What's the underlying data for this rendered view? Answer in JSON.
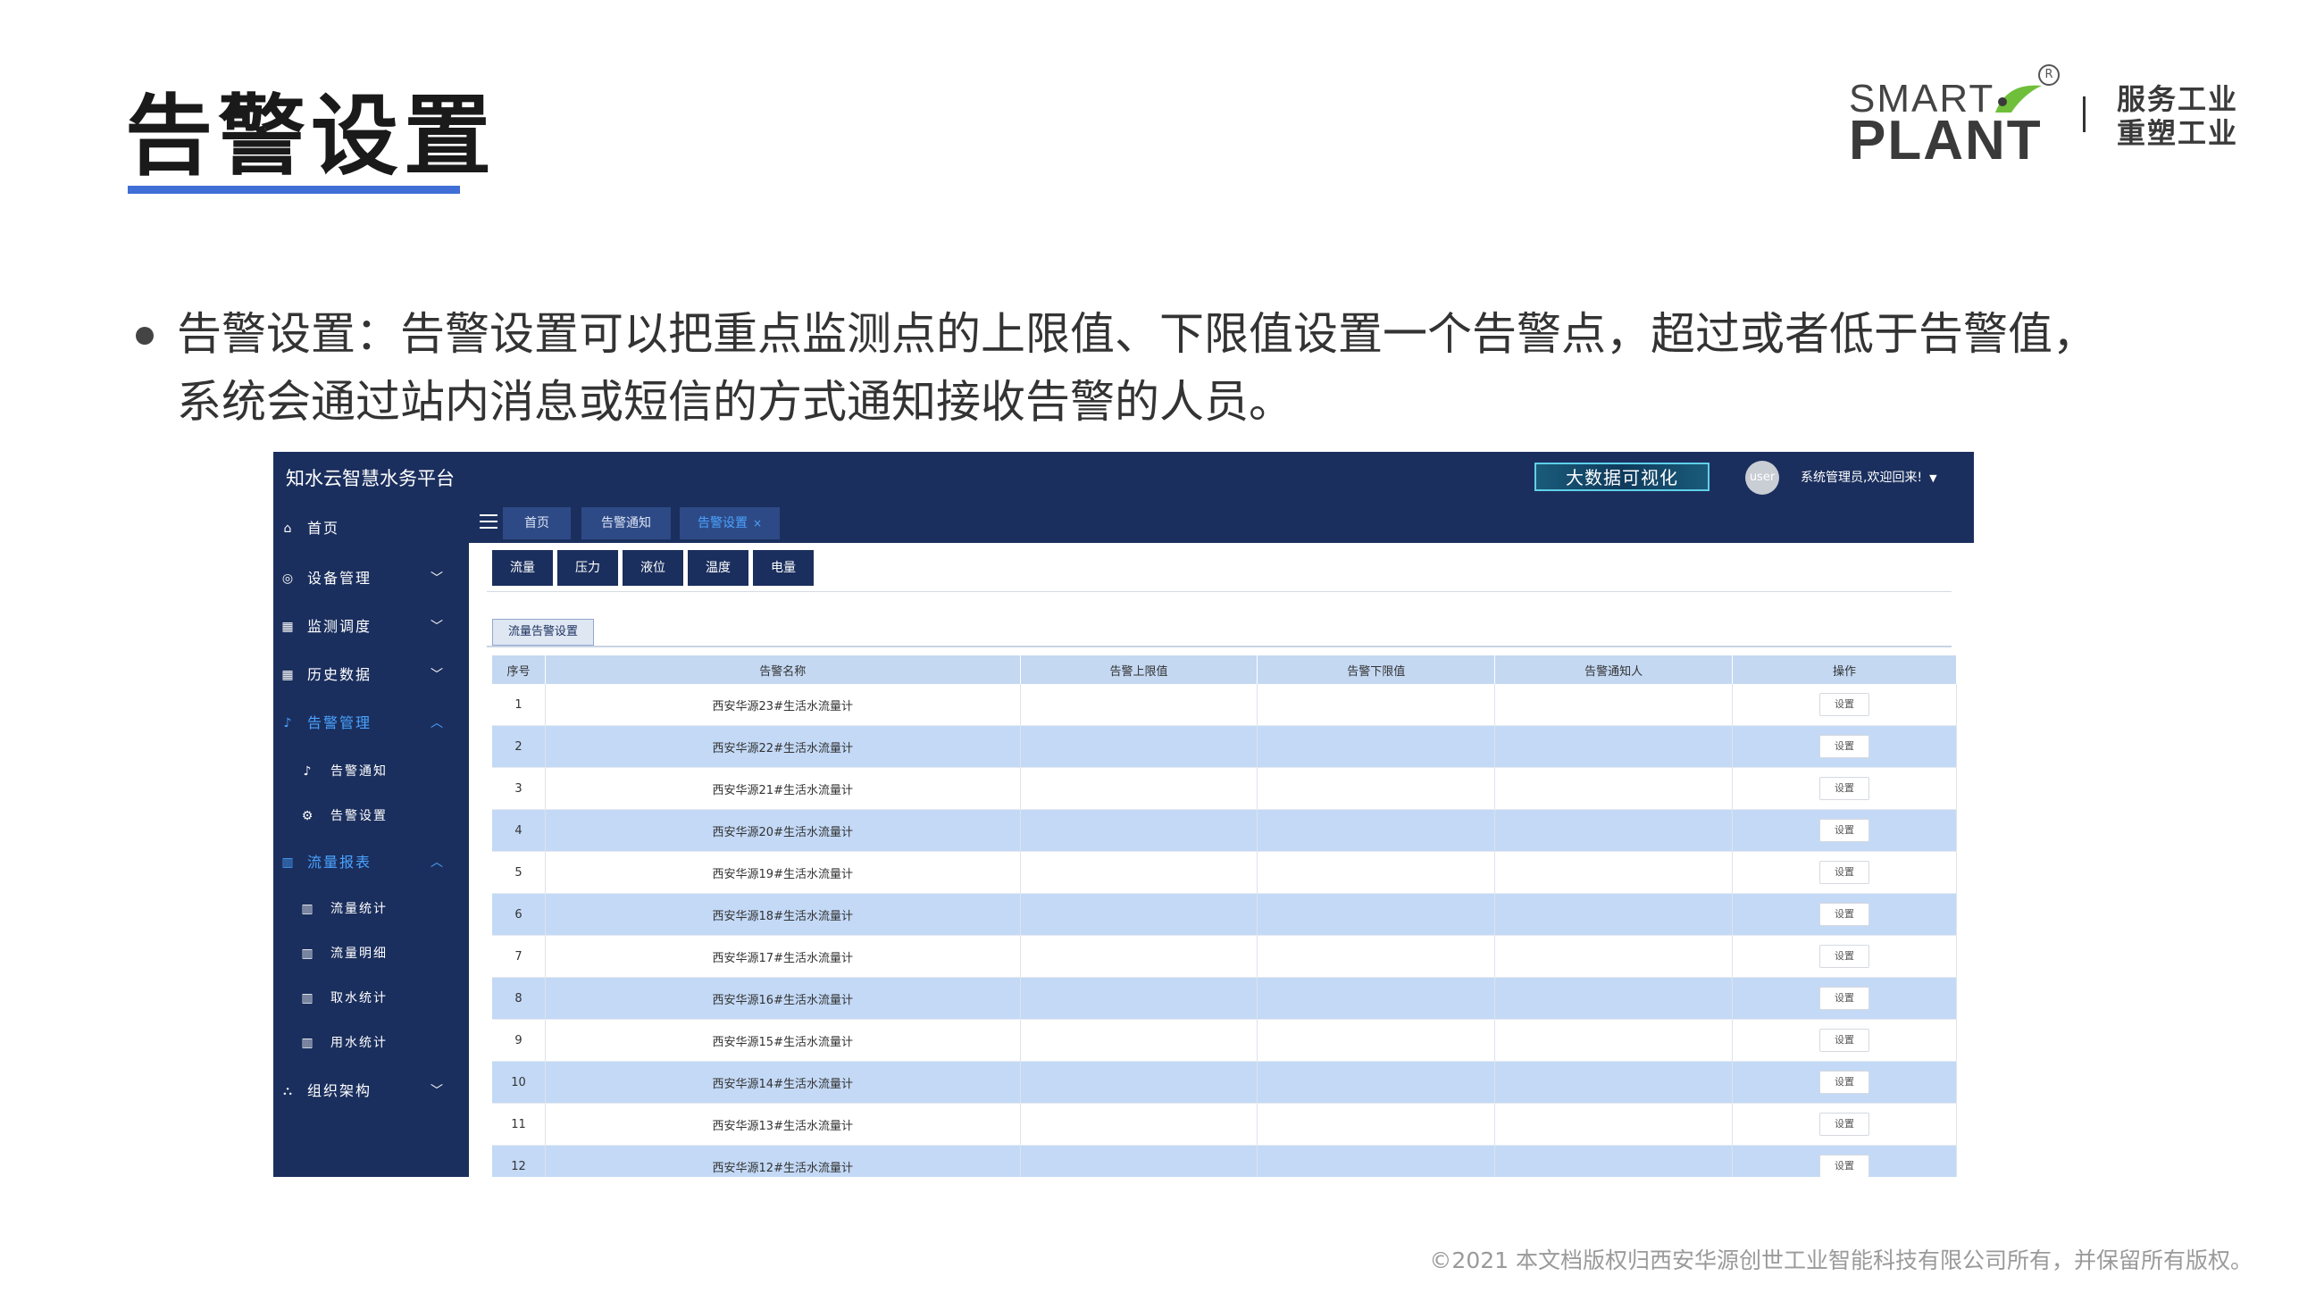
{
  "slide": {
    "title": "告警设置",
    "bullet_line1": "告警设置：告警设置可以把重点监测点的上限值、下限值设置一个告警点，超过或者低于告警值，",
    "bullet_line2": "系统会通过站内消息或短信的方式通知接收告警的人员。",
    "copyright": "©2021 本文档版权归西安华源创世工业智能科技有限公司所有，并保留所有版权。",
    "logo": {
      "smart": "SMART",
      "plant": "PLANT",
      "reg": "R",
      "slogan_line1": "服务工业",
      "slogan_line2": "重塑工业"
    }
  },
  "app": {
    "title": "知水云智慧水务平台",
    "bigdata_button": "大数据可视化",
    "avatar_label": "user",
    "welcome": "系统管理员,欢迎回来!",
    "sidebar": [
      {
        "label": "首页",
        "icon": "home-icon",
        "expandable": false,
        "active": false
      },
      {
        "label": "设备管理",
        "icon": "device-icon",
        "expandable": true,
        "active": false
      },
      {
        "label": "监测调度",
        "icon": "monitor-icon",
        "expandable": true,
        "active": false
      },
      {
        "label": "历史数据",
        "icon": "history-icon",
        "expandable": true,
        "active": false
      },
      {
        "label": "告警管理",
        "icon": "bell-icon",
        "expandable": true,
        "expanded": true,
        "active": true
      },
      {
        "label": "告警通知",
        "icon": "bell-icon",
        "sub": true
      },
      {
        "label": "告警设置",
        "icon": "gear-icon",
        "sub": true
      },
      {
        "label": "流量报表",
        "icon": "bar-chart-icon",
        "expandable": true,
        "expanded": true,
        "active": true
      },
      {
        "label": "流量统计",
        "icon": "bar-chart-icon",
        "sub": true
      },
      {
        "label": "流量明细",
        "icon": "bar-chart-icon",
        "sub": true
      },
      {
        "label": "取水统计",
        "icon": "bar-chart-icon",
        "sub": true
      },
      {
        "label": "用水统计",
        "icon": "bar-chart-icon",
        "sub": true
      },
      {
        "label": "组织架构",
        "icon": "org-icon",
        "expandable": true,
        "active": false
      }
    ],
    "tabs": [
      {
        "label": "首页",
        "active": false
      },
      {
        "label": "告警通知",
        "active": false
      },
      {
        "label": "告警设置",
        "active": true,
        "closable": true
      }
    ],
    "tab_close": "×",
    "subtabs": [
      "流量",
      "压力",
      "液位",
      "温度",
      "电量"
    ],
    "section_title": "流量告警设置",
    "table": {
      "columns": [
        "序号",
        "告警名称",
        "告警上限值",
        "告警下限值",
        "告警通知人",
        "操作"
      ],
      "action_label": "设置",
      "rows": [
        {
          "no": "1",
          "name": "西安华源23#生活水流量计"
        },
        {
          "no": "2",
          "name": "西安华源22#生活水流量计"
        },
        {
          "no": "3",
          "name": "西安华源21#生活水流量计"
        },
        {
          "no": "4",
          "name": "西安华源20#生活水流量计"
        },
        {
          "no": "5",
          "name": "西安华源19#生活水流量计"
        },
        {
          "no": "6",
          "name": "西安华源18#生活水流量计"
        },
        {
          "no": "7",
          "name": "西安华源17#生活水流量计"
        },
        {
          "no": "8",
          "name": "西安华源16#生活水流量计"
        },
        {
          "no": "9",
          "name": "西安华源15#生活水流量计"
        },
        {
          "no": "10",
          "name": "西安华源14#生活水流量计"
        },
        {
          "no": "11",
          "name": "西安华源13#生活水流量计"
        },
        {
          "no": "12",
          "name": "西安华源12#生活水流量计"
        }
      ]
    }
  },
  "colors": {
    "navy": "#1b2f5e",
    "accent": "#3f6fd6",
    "active_link": "#4aa3ff",
    "row_highlight": "#c3d9f6"
  }
}
